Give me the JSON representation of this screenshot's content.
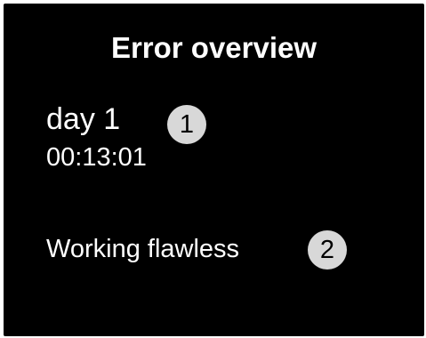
{
  "screen": {
    "title": "Error overview",
    "day_label": "day 1",
    "elapsed_time": "00:13:01",
    "status_text": "Working flawless"
  },
  "callouts": {
    "marker_1": "1",
    "marker_2": "2"
  },
  "colors": {
    "screen_background": "#000000",
    "text": "#ffffff",
    "callout_fill": "#d8d8d8",
    "callout_text": "#000000"
  }
}
